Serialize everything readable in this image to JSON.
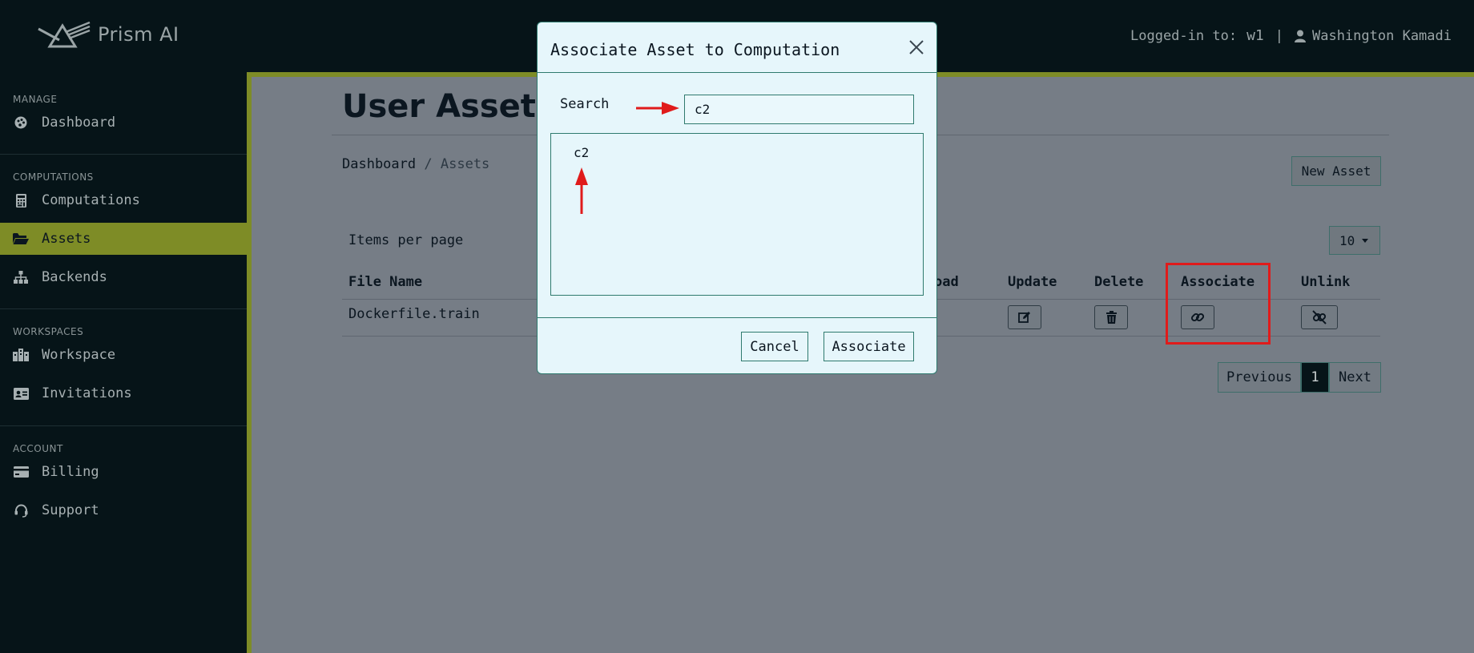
{
  "header": {
    "brand": "Prism AI",
    "logged_in_label": "Logged-in to:",
    "workspace": "w1",
    "separator": "|",
    "user_name": "Washington Kamadi"
  },
  "sidebar": {
    "sections": [
      {
        "heading": "MANAGE",
        "items": [
          {
            "label": "Dashboard",
            "icon": "palette-icon"
          }
        ]
      },
      {
        "heading": "COMPUTATIONS",
        "items": [
          {
            "label": "Computations",
            "icon": "calculator-icon"
          },
          {
            "label": "Assets",
            "icon": "folder-open-icon",
            "active": true
          },
          {
            "label": "Backends",
            "icon": "sitemap-icon"
          }
        ]
      },
      {
        "heading": "WORKSPACES",
        "items": [
          {
            "label": "Workspace",
            "icon": "building-icon"
          },
          {
            "label": "Invitations",
            "icon": "id-card-icon"
          }
        ]
      },
      {
        "heading": "ACCOUNT",
        "items": [
          {
            "label": "Billing",
            "icon": "credit-card-icon"
          },
          {
            "label": "Support",
            "icon": "headset-icon"
          }
        ]
      }
    ],
    "active_color": "#7e8c26"
  },
  "page": {
    "title": "User Assets",
    "breadcrumb": {
      "home": "Dashboard",
      "separator": "/",
      "current": "Assets"
    },
    "new_asset_label": "New Asset",
    "items_per_page_label": "Items per page",
    "items_per_page_value": "10",
    "table": {
      "headers": [
        "File Name",
        "oad",
        "Update",
        "Delete",
        "Associate",
        "Unlink"
      ],
      "rows": [
        {
          "file_name": "Dockerfile.train"
        }
      ]
    },
    "pagination": {
      "previous": "Previous",
      "current": "1",
      "next": "Next"
    }
  },
  "modal": {
    "title": "Associate Asset to Computation",
    "search_label": "Search",
    "search_value": "c2",
    "results": [
      "c2"
    ],
    "cancel_label": "Cancel",
    "associate_label": "Associate"
  },
  "annotation_color": "#e01b1b"
}
